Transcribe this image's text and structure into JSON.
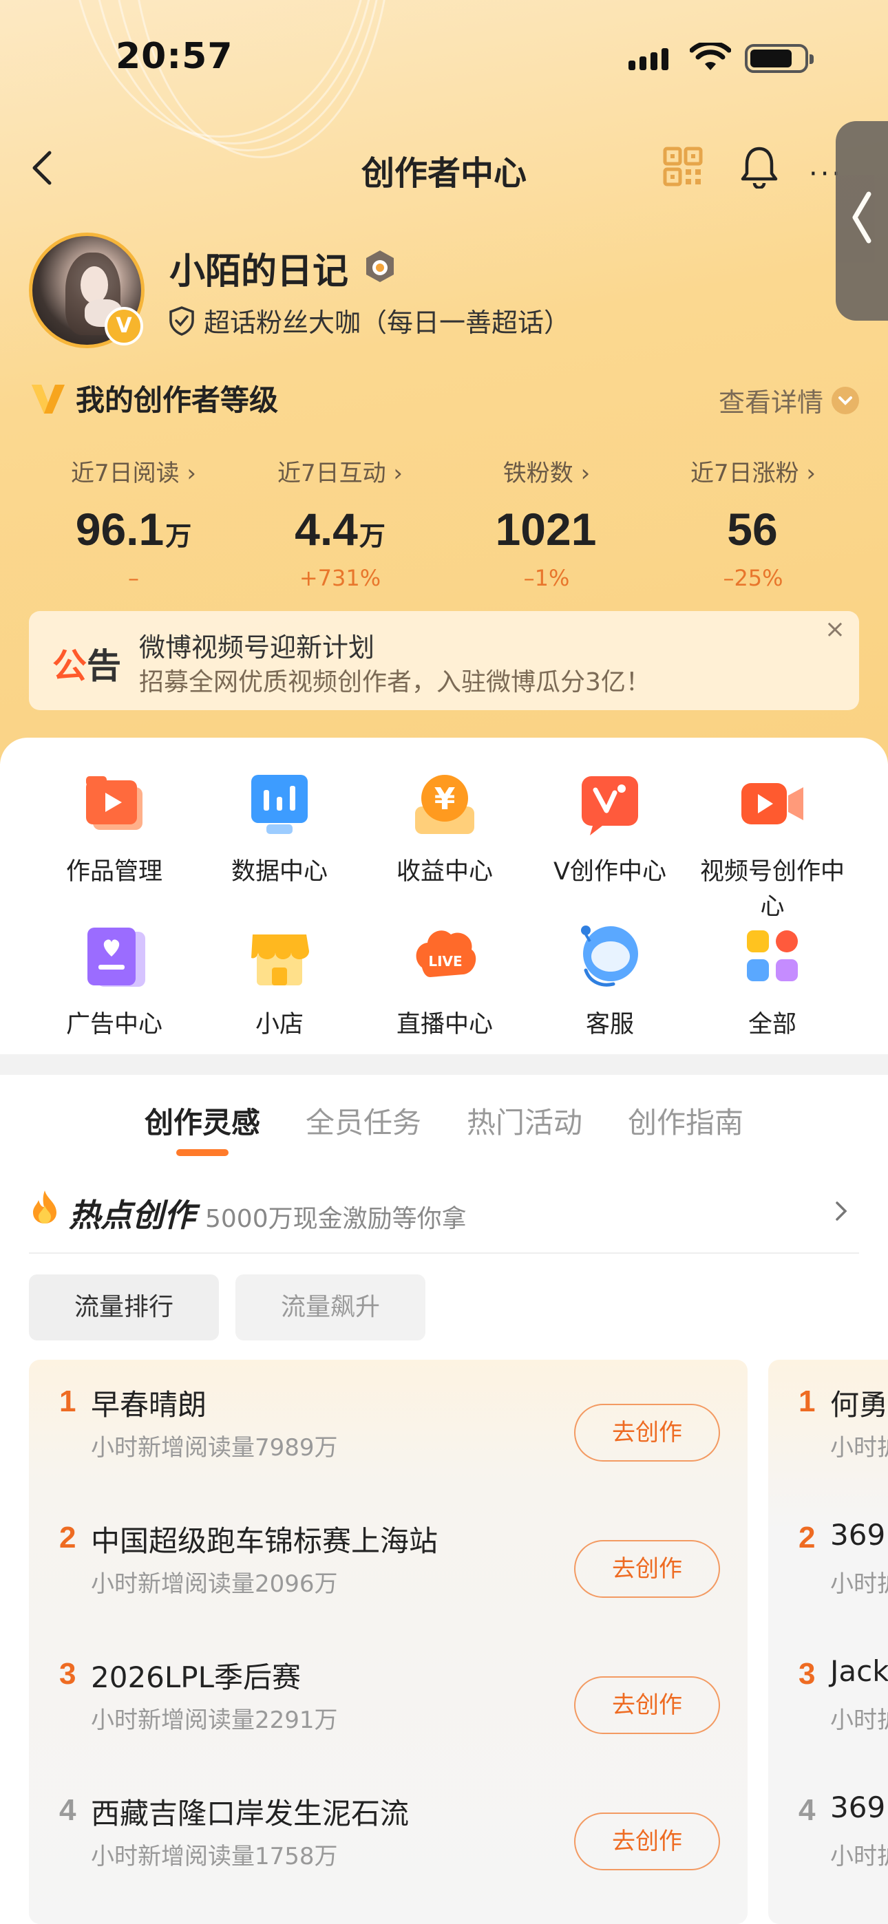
{
  "status_bar": {
    "time": "20:57"
  },
  "nav": {
    "title": "创作者中心",
    "more_icon": "···"
  },
  "profile": {
    "name": "小陌的日记",
    "verified_badge": "V",
    "fan_title": "超话粉丝大咖（每日一善超话）"
  },
  "creator_level": {
    "title": "我的创作者等级",
    "detail_link": "查看详情"
  },
  "stats": [
    {
      "label": "近7日阅读 ›",
      "value": "96.1",
      "unit": "万",
      "change": "–"
    },
    {
      "label": "近7日互动 ›",
      "value": "4.4",
      "unit": "万",
      "change": "+731%"
    },
    {
      "label": "铁粉数 ›",
      "value": "1021",
      "unit": "",
      "change": "–1%"
    },
    {
      "label": "近7日涨粉 ›",
      "value": "56",
      "unit": "",
      "change": "–25%"
    }
  ],
  "notice": {
    "tag_a": "公",
    "tag_b": "告",
    "title": "微博视频号迎新计划",
    "subtitle": "招募全网优质视频创作者，入驻微博瓜分3亿！",
    "close": "×"
  },
  "menu": [
    {
      "label": "作品管理",
      "icon": "works-icon"
    },
    {
      "label": "数据中心",
      "icon": "data-icon"
    },
    {
      "label": "收益中心",
      "icon": "earnings-icon"
    },
    {
      "label": "V创作中心",
      "icon": "v-creator-icon"
    },
    {
      "label": "视频号创作中心",
      "icon": "video-icon"
    },
    {
      "label": "广告中心",
      "icon": "ads-icon"
    },
    {
      "label": "小店",
      "icon": "shop-icon"
    },
    {
      "label": "直播中心",
      "icon": "live-icon"
    },
    {
      "label": "客服",
      "icon": "support-icon"
    },
    {
      "label": "全部",
      "icon": "all-icon"
    }
  ],
  "live_icon_text": "LIVE",
  "earnings_icon_text": "¥",
  "tabs": [
    "创作灵感",
    "全员任务",
    "热门活动",
    "创作指南"
  ],
  "hot": {
    "title": "热点创作",
    "subtitle": "5000万现金激励等你拿"
  },
  "filters": [
    "流量排行",
    "流量飙升"
  ],
  "ranking": [
    {
      "rank": "1",
      "name": "早春晴朗",
      "sub": "小时新增阅读量7989万",
      "button": "去创作"
    },
    {
      "rank": "2",
      "name": "中国超级跑车锦标赛上海站",
      "sub": "小时新增阅读量2096万",
      "button": "去创作"
    },
    {
      "rank": "3",
      "name": "2026LPL季后赛",
      "sub": "小时新增阅读量2291万",
      "button": "去创作"
    },
    {
      "rank": "4",
      "name": "西藏吉隆口岸发生泥石流",
      "sub": "小时新增阅读量1758万",
      "button": "去创作"
    }
  ],
  "ranking2": [
    {
      "rank": "1",
      "name": "何勇",
      "sub": "小时护"
    },
    {
      "rank": "2",
      "name": "369",
      "sub": "小时护"
    },
    {
      "rank": "3",
      "name": "Jack",
      "sub": "小时护"
    },
    {
      "rank": "4",
      "name": "369",
      "sub": "小时护"
    }
  ],
  "colors": {
    "accent": "#ff7a2a",
    "rank_top": "#ee6b22",
    "rank_4": "#9a9a9a"
  }
}
